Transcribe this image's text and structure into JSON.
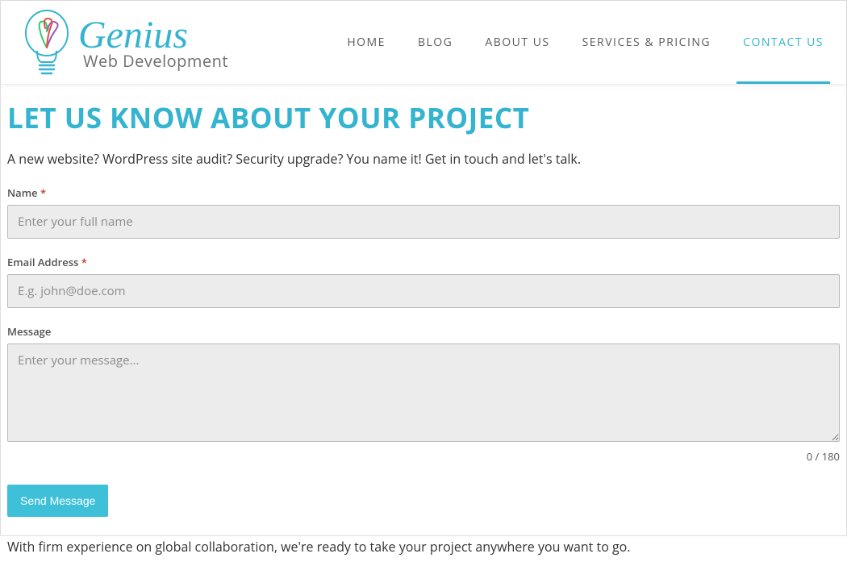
{
  "brand": {
    "name": "Genius",
    "tagline": "Web Development"
  },
  "nav": {
    "items": [
      {
        "label": "HOME",
        "active": false
      },
      {
        "label": "BLOG",
        "active": false
      },
      {
        "label": "ABOUT US",
        "active": false
      },
      {
        "label": "SERVICES & PRICING",
        "active": false
      },
      {
        "label": "CONTACT US",
        "active": true
      }
    ]
  },
  "page": {
    "title": "LET US KNOW ABOUT YOUR PROJECT",
    "intro": "A new website? WordPress site audit? Security upgrade? You name it! Get in touch and let's talk."
  },
  "form": {
    "name": {
      "label": "Name",
      "required_marker": "*",
      "placeholder": "Enter your full name",
      "value": ""
    },
    "email": {
      "label": "Email Address",
      "required_marker": "*",
      "placeholder": "E.g. john@doe.com",
      "value": ""
    },
    "message": {
      "label": "Message",
      "placeholder": "Enter your message...",
      "value": "",
      "counter": "0 / 180"
    },
    "submit_label": "Send Message"
  },
  "footer": {
    "text": "With firm experience on global collaboration, we're ready to take your project anywhere you want to go."
  }
}
